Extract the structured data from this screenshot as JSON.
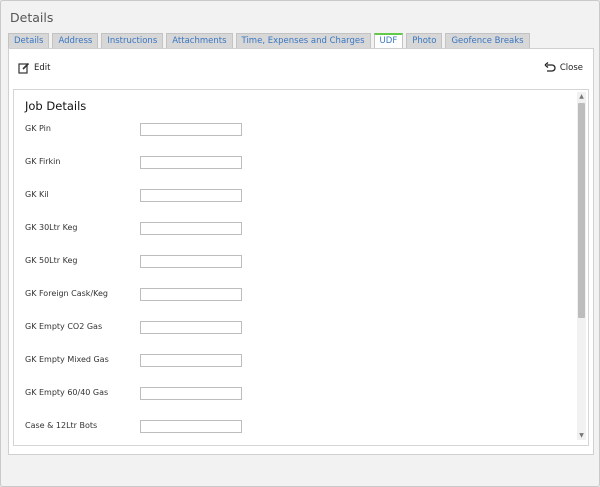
{
  "window": {
    "title": "Details"
  },
  "tabs": [
    {
      "label": "Details"
    },
    {
      "label": "Address"
    },
    {
      "label": "Instructions"
    },
    {
      "label": "Attachments"
    },
    {
      "label": "Time, Expenses and Charges"
    },
    {
      "label": "UDF"
    },
    {
      "label": "Photo"
    },
    {
      "label": "Geofence Breaks"
    }
  ],
  "active_tab": "UDF",
  "toolbar": {
    "edit_label": "Edit",
    "close_label": "Close"
  },
  "form": {
    "title": "Job Details",
    "fields": [
      {
        "label": "GK Pin",
        "value": ""
      },
      {
        "label": "GK Firkin",
        "value": ""
      },
      {
        "label": "GK Kil",
        "value": ""
      },
      {
        "label": "GK 30Ltr Keg",
        "value": ""
      },
      {
        "label": "GK 50Ltr Keg",
        "value": ""
      },
      {
        "label": "GK Foreign Cask/Keg",
        "value": ""
      },
      {
        "label": "GK Empty CO2 Gas",
        "value": ""
      },
      {
        "label": "GK Empty Mixed Gas",
        "value": ""
      },
      {
        "label": "GK Empty 60/40 Gas",
        "value": ""
      },
      {
        "label": "Case & 12Ltr Bots",
        "value": ""
      }
    ]
  },
  "colors": {
    "active_tab_accent": "#62c94a",
    "link": "#3a76c2"
  }
}
